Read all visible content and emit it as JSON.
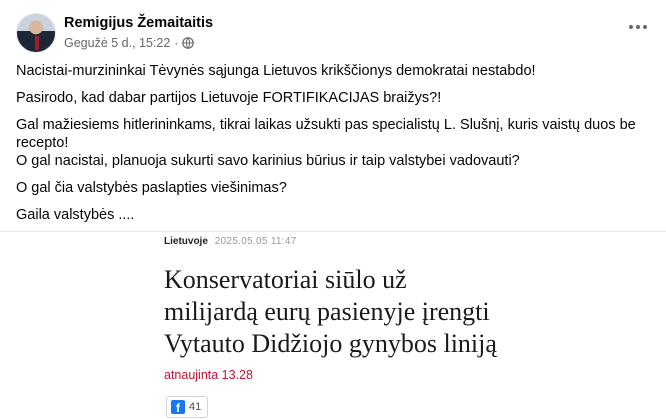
{
  "post": {
    "author": "Remigijus Žemaitaitis",
    "date": "Gegužė 5 d., 15:22",
    "separator": "·",
    "audience_icon": "globe-icon",
    "more_icon": "more-options-icon",
    "lines": [
      "Nacistai-murzininkai Tėvynės sąjunga Lietuvos krikščionys demokratai nestabdo!",
      "Pasirodo, kad dabar partijos Lietuvoje FORTIFIKACIJAS braižys?!",
      "Gal mažiesiems hitlerininkams, tikrai laikas užsukti pas specialistų L. Slušnį, kuris vaistų duos be",
      "recepto!",
      "O gal nacistai, planuoja sukurti savo karinius būrius ir taip valstybei vadovauti?",
      "O gal čia valstybės paslapties viešinimas?",
      "Gaila valstybės ...."
    ]
  },
  "article": {
    "category": "Lietuvoje",
    "date": "2025.05.05 11:47",
    "headline_lines": [
      "Konservatoriai siūlo už",
      "milijardą eurų pasienyje įrengti",
      "Vytauto Didžiojo gynybos liniją"
    ],
    "updated": "atnaujinta 13.28",
    "share_count": "41",
    "accent_color": "#c8102e",
    "facebook_color": "#1877f2"
  }
}
